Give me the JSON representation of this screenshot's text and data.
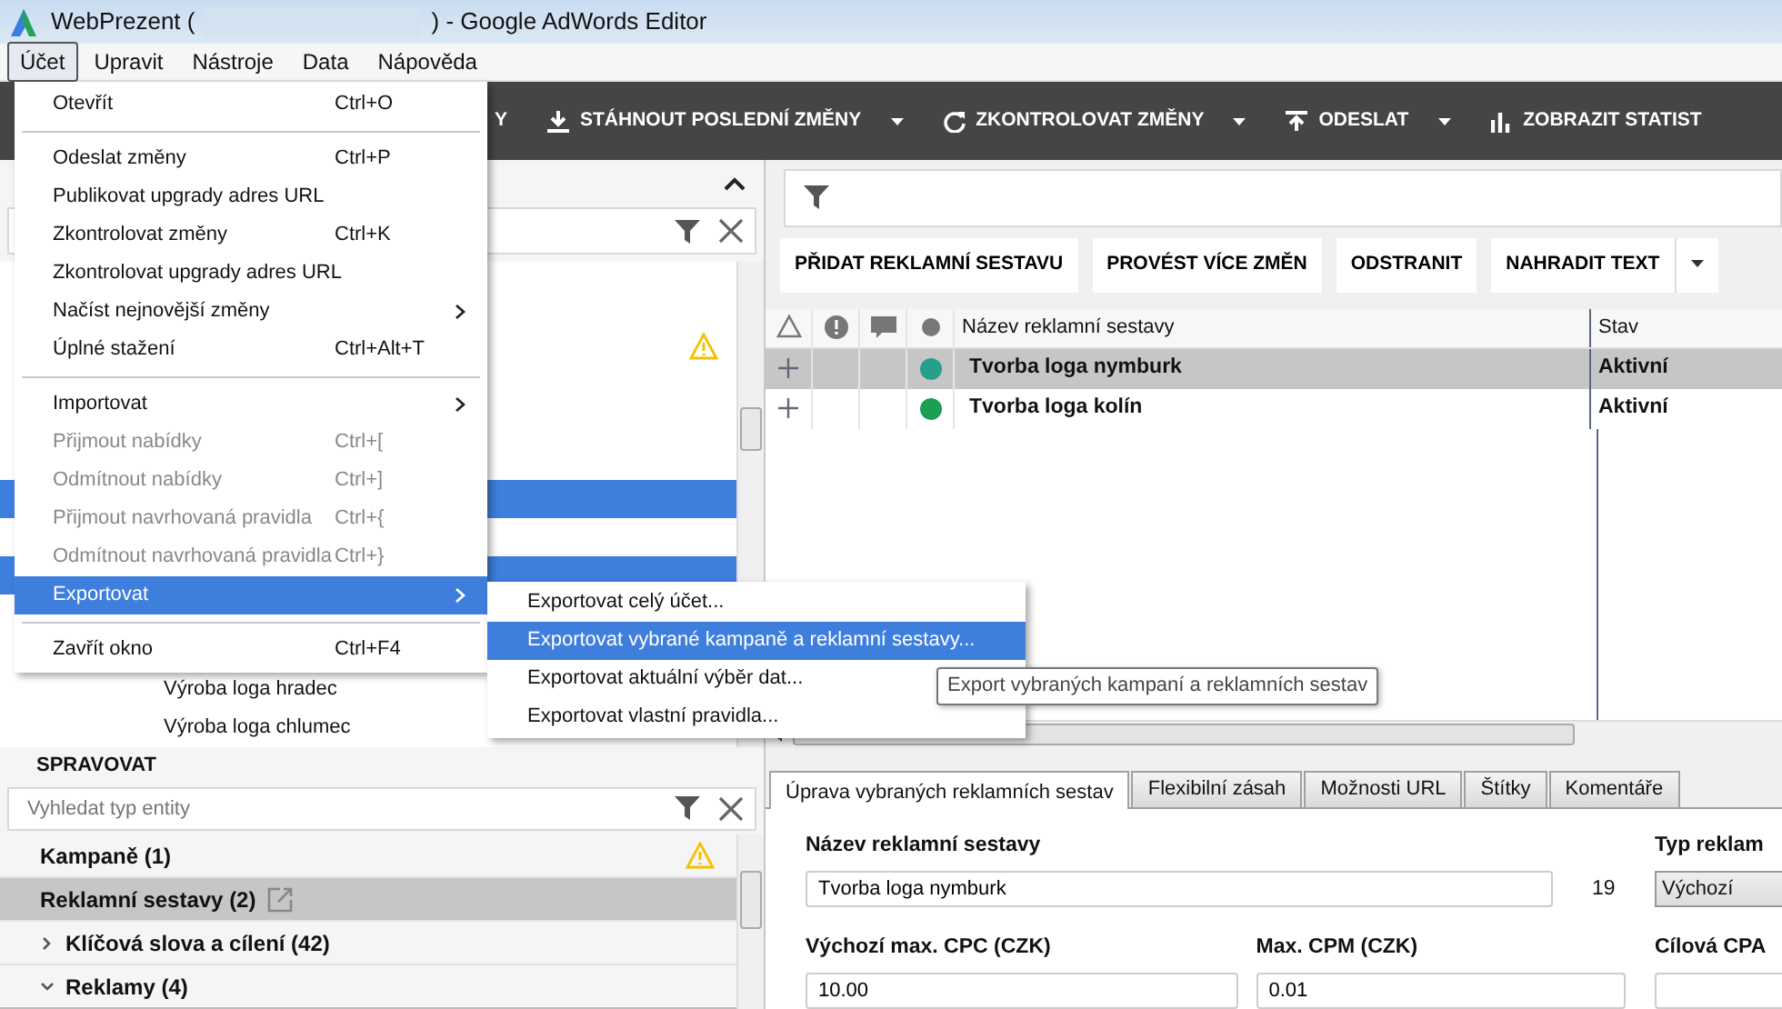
{
  "window": {
    "title_before": "WebPrezent (",
    "title_after": ") - Google AdWords Editor"
  },
  "menu_bar": [
    {
      "label": "Účet",
      "selected": true
    },
    {
      "label": "Upravit",
      "selected": false
    },
    {
      "label": "Nástroje",
      "selected": false
    },
    {
      "label": "Data",
      "selected": false
    },
    {
      "label": "Nápověda",
      "selected": false
    }
  ],
  "toolbar": [
    {
      "label": "Y",
      "kind": "plain",
      "dropdown": false
    },
    {
      "label": "STÁHNOUT POSLEDNÍ ZMĚNY",
      "kind": "download",
      "dropdown": true
    },
    {
      "label": "ZKONTROLOVAT ZMĚNY",
      "kind": "refresh",
      "dropdown": true
    },
    {
      "label": "ODESLAT",
      "kind": "upload",
      "dropdown": true
    },
    {
      "label": "ZOBRAZIT STATIST",
      "kind": "chart",
      "dropdown": false
    }
  ],
  "account_tree": {
    "rows": [
      {
        "label": "",
        "selected": false,
        "warning": true
      },
      {
        "label": "",
        "selected": false
      },
      {
        "label": "",
        "selected": false
      },
      {
        "label": "",
        "selected": false
      },
      {
        "label": "",
        "selected": true
      },
      {
        "label": "",
        "selected": false
      },
      {
        "label": "",
        "selected": true
      },
      {
        "label": "",
        "selected": false
      },
      {
        "label": "",
        "selected": false
      },
      {
        "label": "Výroba loga hradec",
        "selected": false
      },
      {
        "label": "Výroba loga chlumec",
        "selected": false
      }
    ]
  },
  "manage": {
    "title": "SPRAVOVAT",
    "search": {
      "placeholder": "Vyhledat typ entity"
    },
    "items": [
      {
        "label": "Kampaně (1)",
        "kind": "plain",
        "expanded": false,
        "selected": false,
        "warning": true,
        "external": false
      },
      {
        "label": "Reklamní sestavy (2)",
        "kind": "plain",
        "expanded": false,
        "selected": true,
        "warning": false,
        "external": true
      },
      {
        "label": "Klíčová slova a cílení (42)",
        "kind": "group",
        "expanded": false,
        "selected": false,
        "warning": false,
        "external": false
      },
      {
        "label": "Reklamy (4)",
        "kind": "group",
        "expanded": true,
        "selected": false,
        "warning": false,
        "external": false
      }
    ]
  },
  "actions": [
    "PŘIDAT REKLAMNÍ SESTAVU",
    "PROVÉST VÍCE ZMĚN",
    "ODSTRANIT",
    "NAHRADIT TEXT"
  ],
  "table": {
    "columns": [
      "Název reklamní sestavy",
      "Stav"
    ],
    "rows": [
      {
        "name": "Tvorba loga nymburk",
        "status": "Aktivní",
        "color": "#26a08a",
        "selected": true
      },
      {
        "name": "Tvorba loga kolín",
        "status": "Aktivní",
        "color": "#1c9e55",
        "selected": false
      }
    ]
  },
  "tabs": [
    {
      "label": "Úprava vybraných reklamních sestav",
      "selected": true
    },
    {
      "label": "Flexibilní zásah",
      "selected": false
    },
    {
      "label": "Možnosti URL",
      "selected": false
    },
    {
      "label": "Štítky",
      "selected": false
    },
    {
      "label": "Komentáře",
      "selected": false
    }
  ],
  "form": {
    "name_label": "Název reklamní sestavy",
    "name_value": "Tvorba loga nymburk",
    "name_count": "19",
    "type_label": "Typ reklam",
    "type_value": "Výchozí",
    "cpc_label": "Výchozí max. CPC (CZK)",
    "cpc_value": "10.00",
    "cpm_label": "Max. CPM (CZK)",
    "cpm_value": "0.01",
    "cpa_label": "Cílová CPA"
  },
  "menu": {
    "items": [
      {
        "kind": "item",
        "label": "Otevřít",
        "shortcut": "Ctrl+O",
        "disabled": false,
        "submenu": false,
        "selected": false
      },
      {
        "kind": "separator"
      },
      {
        "kind": "item",
        "label": "Odeslat změny",
        "shortcut": "Ctrl+P",
        "disabled": false,
        "submenu": false,
        "selected": false
      },
      {
        "kind": "item",
        "label": "Publikovat upgrady adres URL",
        "disabled": false,
        "submenu": false,
        "selected": false
      },
      {
        "kind": "item",
        "label": "Zkontrolovat změny",
        "shortcut": "Ctrl+K",
        "disabled": false,
        "submenu": false,
        "selected": false
      },
      {
        "kind": "item",
        "label": "Zkontrolovat upgrady adres URL",
        "disabled": false,
        "submenu": false,
        "selected": false
      },
      {
        "kind": "item",
        "label": "Načíst nejnovější změny",
        "disabled": false,
        "submenu": true,
        "selected": false
      },
      {
        "kind": "item",
        "label": "Úplné stažení",
        "shortcut": "Ctrl+Alt+T",
        "disabled": false,
        "submenu": false,
        "selected": false
      },
      {
        "kind": "separator"
      },
      {
        "kind": "item",
        "label": "Importovat",
        "disabled": false,
        "submenu": true,
        "selected": false
      },
      {
        "kind": "item",
        "label": "Přijmout nabídky",
        "shortcut": "Ctrl+[",
        "disabled": true,
        "submenu": false,
        "selected": false
      },
      {
        "kind": "item",
        "label": "Odmítnout nabídky",
        "shortcut": "Ctrl+]",
        "disabled": true,
        "submenu": false,
        "selected": false
      },
      {
        "kind": "item",
        "label": "Přijmout navrhovaná pravidla",
        "shortcut": "Ctrl+{",
        "disabled": true,
        "submenu": false,
        "selected": false
      },
      {
        "kind": "item",
        "label": "Odmítnout navrhovaná pravidla",
        "shortcut": "Ctrl+}",
        "disabled": true,
        "submenu": false,
        "selected": false
      },
      {
        "kind": "item",
        "label": "Exportovat",
        "disabled": false,
        "submenu": true,
        "selected": true
      },
      {
        "kind": "separator"
      },
      {
        "kind": "item",
        "label": "Zavřít okno",
        "shortcut": "Ctrl+F4",
        "disabled": false,
        "submenu": false,
        "selected": false
      }
    ]
  },
  "submenu": {
    "items": [
      {
        "label": "Exportovat celý účet...",
        "selected": false
      },
      {
        "label": "Exportovat vybrané kampaně a reklamní sestavy...",
        "selected": true
      },
      {
        "label": "Exportovat aktuální výběr dat...",
        "selected": false
      },
      {
        "label": "Exportovat vlastní pravidla...",
        "selected": false
      }
    ]
  },
  "tooltip": "Export vybraných kampaní a reklamních sestav"
}
